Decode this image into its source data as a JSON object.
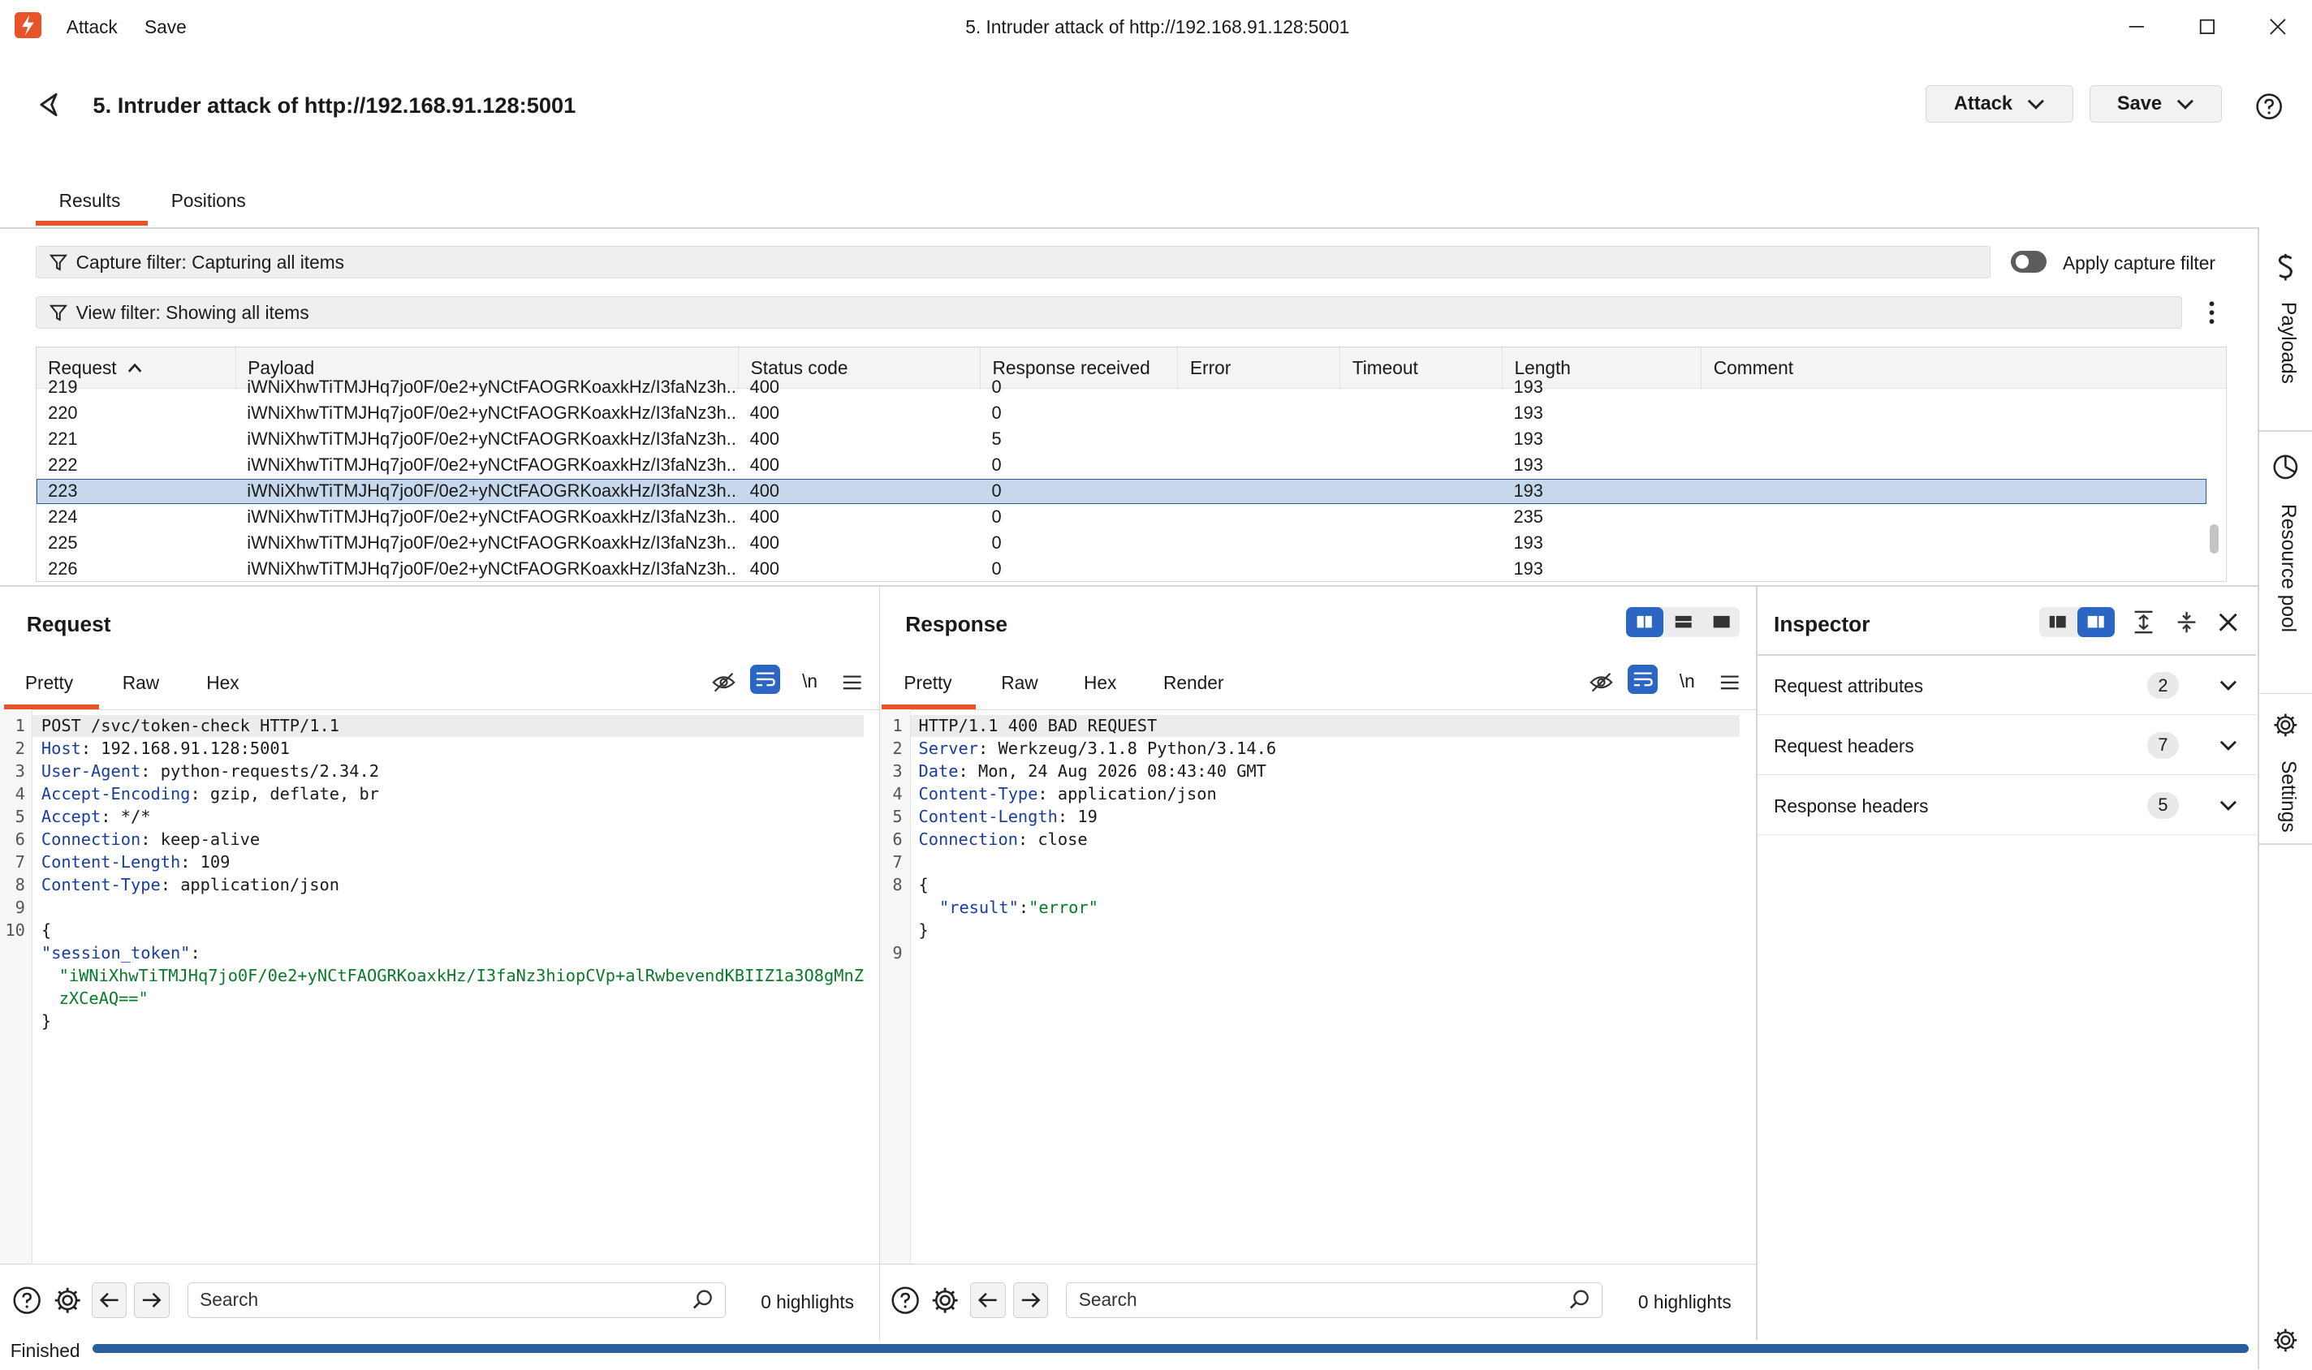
{
  "titlebar": {
    "menu": [
      "Attack",
      "Save"
    ],
    "title": "5. Intruder attack of http://192.168.91.128:5001"
  },
  "header": {
    "title": "5. Intruder attack of http://192.168.91.128:5001",
    "attack_label": "Attack",
    "save_label": "Save"
  },
  "tabs": [
    {
      "label": "Results",
      "active": true
    },
    {
      "label": "Positions",
      "active": false
    }
  ],
  "filters": {
    "capture": "Capture filter: Capturing all items",
    "apply_capture": "Apply capture filter",
    "view": "View filter: Showing all items"
  },
  "table": {
    "columns": [
      "Request",
      "Payload",
      "Status code",
      "Response received",
      "Error",
      "Timeout",
      "Length",
      "Comment"
    ],
    "rows": [
      {
        "request": "219",
        "payload": "iWNiXhwTiTMJHq7jo0F/0e2+yNCtFAOGRKoaxkHz/I3faNz3h...",
        "status": "400",
        "received": "0",
        "error": "",
        "timeout": "",
        "length": "193",
        "comment": ""
      },
      {
        "request": "220",
        "payload": "iWNiXhwTiTMJHq7jo0F/0e2+yNCtFAOGRKoaxkHz/I3faNz3h...",
        "status": "400",
        "received": "0",
        "error": "",
        "timeout": "",
        "length": "193",
        "comment": ""
      },
      {
        "request": "221",
        "payload": "iWNiXhwTiTMJHq7jo0F/0e2+yNCtFAOGRKoaxkHz/I3faNz3h...",
        "status": "400",
        "received": "5",
        "error": "",
        "timeout": "",
        "length": "193",
        "comment": ""
      },
      {
        "request": "222",
        "payload": "iWNiXhwTiTMJHq7jo0F/0e2+yNCtFAOGRKoaxkHz/I3faNz3h...",
        "status": "400",
        "received": "0",
        "error": "",
        "timeout": "",
        "length": "193",
        "comment": ""
      },
      {
        "request": "223",
        "payload": "iWNiXhwTiTMJHq7jo0F/0e2+yNCtFAOGRKoaxkHz/I3faNz3h...",
        "status": "400",
        "received": "0",
        "error": "",
        "timeout": "",
        "length": "193",
        "comment": "",
        "selected": true
      },
      {
        "request": "224",
        "payload": "iWNiXhwTiTMJHq7jo0F/0e2+yNCtFAOGRKoaxkHz/I3faNz3h...",
        "status": "400",
        "received": "0",
        "error": "",
        "timeout": "",
        "length": "235",
        "comment": ""
      },
      {
        "request": "225",
        "payload": "iWNiXhwTiTMJHq7jo0F/0e2+yNCtFAOGRKoaxkHz/I3faNz3h...",
        "status": "400",
        "received": "0",
        "error": "",
        "timeout": "",
        "length": "193",
        "comment": ""
      },
      {
        "request": "226",
        "payload": "iWNiXhwTiTMJHq7jo0F/0e2+yNCtFAOGRKoaxkHz/I3faNz3h...",
        "status": "400",
        "received": "0",
        "error": "",
        "timeout": "",
        "length": "193",
        "comment": ""
      }
    ]
  },
  "request_pane": {
    "title": "Request",
    "tabs": [
      "Pretty",
      "Raw",
      "Hex"
    ],
    "lines": [
      {
        "n": "1",
        "k": "",
        "v": "POST /svc/token-check HTTP/1.1"
      },
      {
        "n": "2",
        "k": "Host",
        "v": ": 192.168.91.128:5001"
      },
      {
        "n": "3",
        "k": "User-Agent",
        "v": ": python-requests/2.34.2"
      },
      {
        "n": "4",
        "k": "Accept-Encoding",
        "v": ": gzip, deflate, br"
      },
      {
        "n": "5",
        "k": "Accept",
        "v": ": */*"
      },
      {
        "n": "6",
        "k": "Connection",
        "v": ": keep-alive"
      },
      {
        "n": "7",
        "k": "Content-Length",
        "v": ": 109"
      },
      {
        "n": "8",
        "k": "Content-Type",
        "v": ": application/json"
      },
      {
        "n": "9",
        "k": "",
        "v": ""
      },
      {
        "n": "10",
        "k": "",
        "v": "{"
      }
    ],
    "json_key": "\"session_token\"",
    "json_sep": ":",
    "json_value_1": "\"iWNiXhwTiTMJHq7jo0F/0e2+yNCtFAOGRKoaxkHz/I3faNz3hiopCVp+alRwbevendKBIIZ1a3O8gMnZ",
    "json_value_2": "zXCeAQ==\"",
    "json_close": "}",
    "search_placeholder": "Search",
    "highlights": "0 highlights"
  },
  "response_pane": {
    "title": "Response",
    "tabs": [
      "Pretty",
      "Raw",
      "Hex",
      "Render"
    ],
    "lines": [
      {
        "n": "1",
        "k": "",
        "v": "HTTP/1.1 400 BAD REQUEST"
      },
      {
        "n": "2",
        "k": "Server",
        "v": ": Werkzeug/3.1.8 Python/3.14.6"
      },
      {
        "n": "3",
        "k": "Date",
        "v": ": Mon, 24 Aug 2026 08:43:40 GMT"
      },
      {
        "n": "4",
        "k": "Content-Type",
        "v": ": application/json"
      },
      {
        "n": "5",
        "k": "Content-Length",
        "v": ": 19"
      },
      {
        "n": "6",
        "k": "Connection",
        "v": ": close"
      },
      {
        "n": "7",
        "k": "",
        "v": ""
      },
      {
        "n": "8",
        "k": "",
        "v": "{"
      }
    ],
    "json_key": "\"result\"",
    "json_sep": ":",
    "json_value": "\"error\"",
    "json_close": "}",
    "last_line": "9",
    "search_placeholder": "Search",
    "highlights": "0 highlights"
  },
  "inspector": {
    "title": "Inspector",
    "sections": [
      {
        "label": "Request attributes",
        "count": "2"
      },
      {
        "label": "Request headers",
        "count": "7"
      },
      {
        "label": "Response headers",
        "count": "5"
      }
    ]
  },
  "sidebar": {
    "items": [
      "Payloads",
      "Resource pool",
      "Settings"
    ]
  },
  "status": {
    "label": "Finished",
    "progress": 1.0
  },
  "colors": {
    "accent": "#e8542a",
    "selection": "#c8d8ec",
    "progress": "#2a5d9b",
    "toggle_active": "#2b66c4"
  }
}
